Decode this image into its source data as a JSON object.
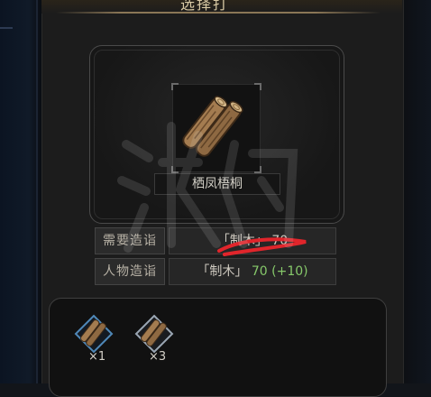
{
  "window": {
    "title": "选择打"
  },
  "item": {
    "name": "栖凤梧桐",
    "icon": "wood-log-icon"
  },
  "requirements": {
    "required": {
      "label": "需要造诣",
      "bracket_text": "「制木」",
      "value": "70"
    },
    "character": {
      "label": "人物造诣",
      "bracket_text": "「制木」",
      "value": "70",
      "bonus": "(+10)"
    }
  },
  "inventory": [
    {
      "icon": "wood-log-icon",
      "count": "×1",
      "frame_color": "#4f88b8"
    },
    {
      "icon": "wood-log-icon",
      "count": "×3",
      "frame_color": "#9aa6b3"
    }
  ],
  "overlay": {
    "watermark_text": "游侠网",
    "annotation_color": "#e0252b"
  },
  "colors": {
    "accent_gold": "#d8c9a4",
    "bonus_green": "#86c86a"
  }
}
